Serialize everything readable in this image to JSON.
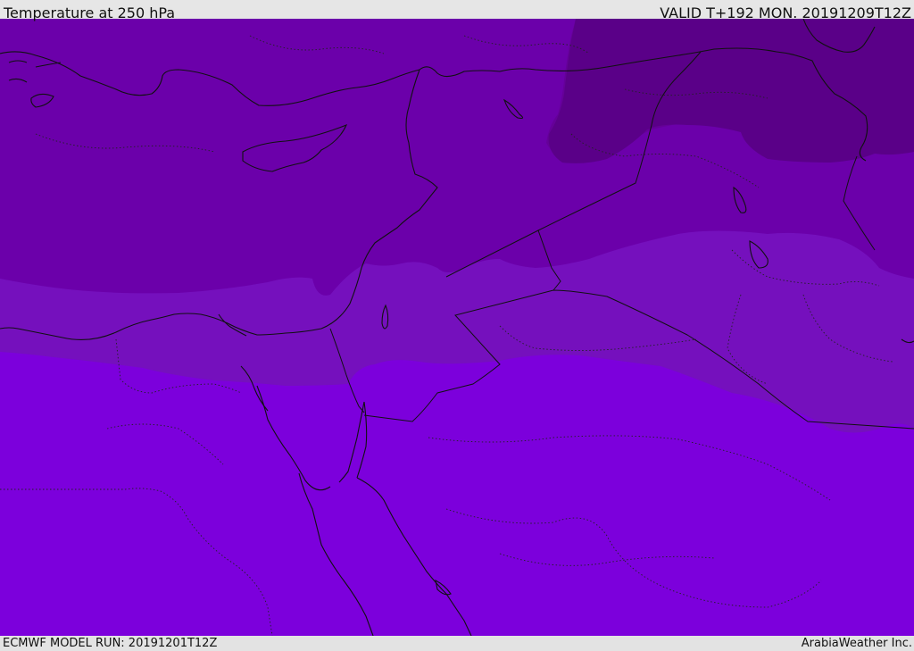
{
  "header": {
    "title": "Temperature at 250 hPa",
    "valid": "VALID T+192 MON. 20191209T12Z"
  },
  "footer": {
    "model_run": "ECMWF MODEL RUN: 20191201T12Z",
    "credit": "ArabiaWeather Inc."
  },
  "map": {
    "colors": {
      "coldest": "#5a0088",
      "cold": "#650099",
      "cool": "#6b00aa",
      "mid": "#7510bd",
      "warm": "#7c00dc",
      "coast": "#111111"
    }
  }
}
